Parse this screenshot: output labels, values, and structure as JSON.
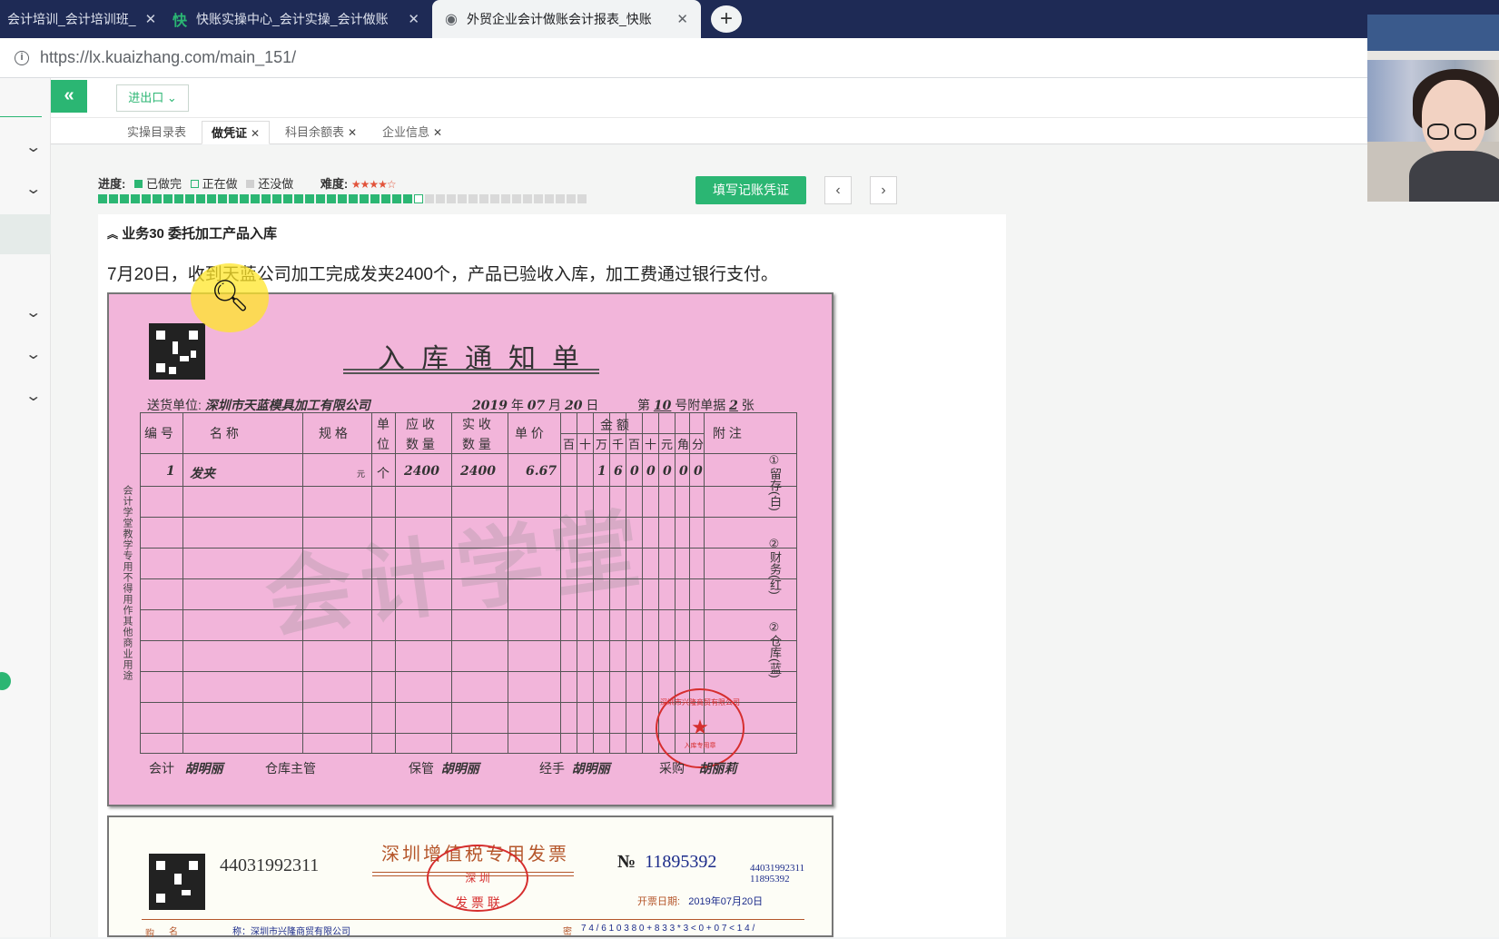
{
  "browser": {
    "tabs": [
      {
        "title": "会计培训_会计培训班_",
        "icon": "none"
      },
      {
        "title": "快账实操中心_会计实操_会计做账",
        "icon": "kuai-logo"
      },
      {
        "title": "外贸企业会计做账会计报表_快账",
        "icon": "globe-icon"
      }
    ],
    "url": "https://lx.kuaizhang.com/main_151/"
  },
  "toolbar": {
    "io_label": "进出口"
  },
  "page_tabs": [
    {
      "label": "实操目录表",
      "closable": false
    },
    {
      "label": "做凭证",
      "closable": true,
      "active": true
    },
    {
      "label": "科目余额表",
      "closable": true
    },
    {
      "label": "企业信息",
      "closable": true
    }
  ],
  "progress": {
    "label": "进度:",
    "done_label": "已做完",
    "doing_label": "正在做",
    "todo_label": "还没做",
    "difficulty_label": "难度:",
    "difficulty_stars": 4,
    "completed": 29,
    "total": 45
  },
  "actions": {
    "fill_voucher": "填写记账凭证",
    "prev": "‹",
    "next": "›"
  },
  "business": {
    "title": "业务30 委托加工产品入库",
    "description": "7月20日，收到天蓝公司加工完成发夹2400个，产品已验收入库，加工费通过银行支付。"
  },
  "receipt": {
    "title": "入库通知单",
    "supplier_label": "送货单位:",
    "supplier": "深圳市天蓝模具加工有限公司",
    "year": "2019",
    "year_label": "年",
    "month": "07",
    "month_label": "月",
    "day": "20",
    "day_label": "日",
    "no_prefix": "第",
    "no": "10",
    "no_mid": "号附单据",
    "attach": "2",
    "attach_suffix": "张",
    "headers": {
      "code": "编 号",
      "name": "名    称",
      "spec": "规 格",
      "unit1": "单",
      "unit2": "位",
      "due1": "应 收",
      "due2": "数 量",
      "recv1": "实 收",
      "recv2": "数 量",
      "price": "单 价",
      "amount": "金    额",
      "note": "附 注"
    },
    "amount_digits": [
      "百",
      "十",
      "万",
      "千",
      "百",
      "十",
      "元",
      "角",
      "分"
    ],
    "row": {
      "code": "1",
      "name": "发夹",
      "spec_mark": "元",
      "unit": "个",
      "due_qty": "2400",
      "recv_qty": "2400",
      "price": "6.67",
      "amount_digits": [
        "",
        "",
        "1",
        "6",
        "0",
        "0",
        "0",
        "0",
        "0"
      ]
    },
    "left_note": "会计学堂教学专用不得用作其他商业用途",
    "right_notes": [
      "①留存(白)",
      "②财务(红)",
      "②仓库(蓝)"
    ],
    "signatures": {
      "accountant_label": "会计",
      "accountant": "胡明丽",
      "warehouse_label": "仓库主管",
      "keeper_label": "保管",
      "keeper": "胡明丽",
      "handler_label": "经手",
      "handler": "胡明丽",
      "purchase_label": "采购",
      "purchase": "胡丽莉"
    },
    "watermark": "会计学堂",
    "stamp_text": "深圳市兴隆商贸有限公司",
    "stamp_sub": "入库专用章"
  },
  "invoice": {
    "title": "深圳增值税专用发票",
    "code": "44031992311",
    "no_label": "№",
    "no": "11895392",
    "small_code": "44031992311",
    "small_no": "11895392",
    "date_label": "开票日期:",
    "date": "2019年07月20日",
    "stamp_city": "深 圳",
    "stamp_bottom": "发 票 联",
    "buyer_name_label": "名",
    "buyer_name_text": "称：深圳市兴隆商贸有限公司",
    "pwd_label": "密",
    "pwd_partial": "7 4 /  6 1 0 3 8 0 +   8 3   3 * 3 < 0 + 0   7 < 1 4 /",
    "buyer_side": "购"
  },
  "colors": {
    "accent": "#2bb673",
    "receipt_bg": "#f2b5da",
    "stamp_red": "#d62e2e",
    "tabbar": "#1e2a55"
  }
}
